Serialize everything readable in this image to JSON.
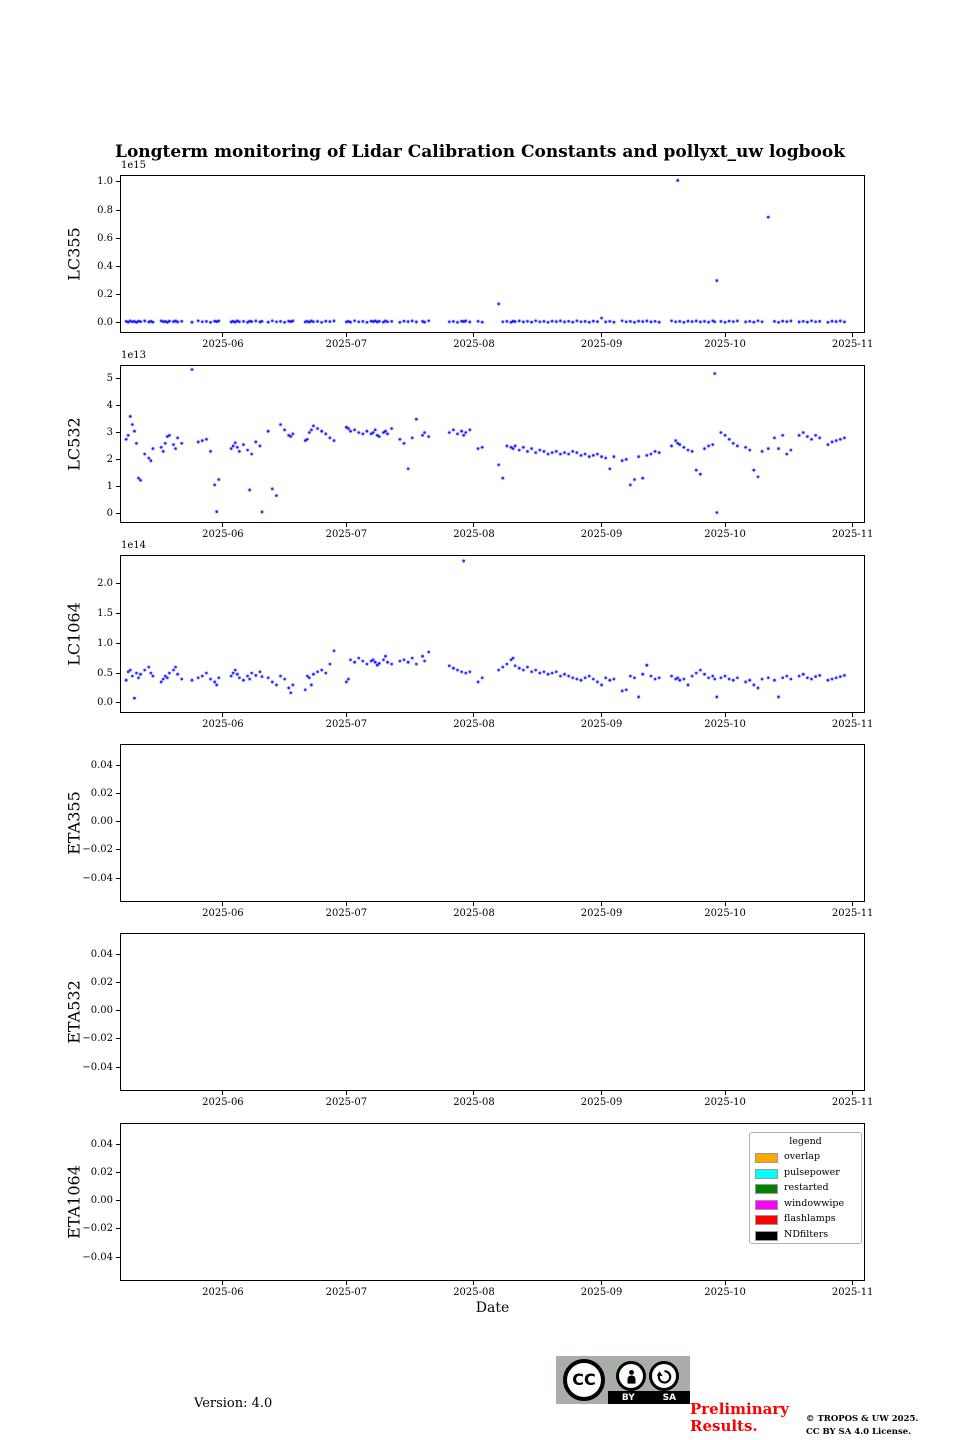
{
  "title": "Longterm monitoring of Lidar Calibration Constants and pollyxt_uw logbook",
  "xlabel": "Date",
  "marker_color": "#0000ff",
  "legend": {
    "title": "legend",
    "entries": [
      {
        "label": "overlap",
        "color": "#ffa500"
      },
      {
        "label": "pulsepower",
        "color": "#00ffff"
      },
      {
        "label": "restarted",
        "color": "#008000"
      },
      {
        "label": "windowwipe",
        "color": "#ff00ff"
      },
      {
        "label": "flashlamps",
        "color": "#ff0000"
      },
      {
        "label": "NDfilters",
        "color": "#000000"
      }
    ]
  },
  "footer": {
    "version": "Version: 4.0",
    "preliminary_line1": "Preliminary",
    "preliminary_line2": "Results.",
    "preliminary_color": "#ff0000",
    "copyright_line1": "© TROPOS & UW 2025.",
    "copyright_line2": "CC BY SA 4.0 License.",
    "cc_badge": {
      "cc_text": "CC",
      "by_label": "BY",
      "sa_label": "SA"
    }
  },
  "chart_data": [
    {
      "type": "scatter",
      "ylabel": "LC355",
      "offset_label": "1e15",
      "ylim": [
        -0.071,
        1.049
      ],
      "yticks": [
        0.0,
        0.2,
        0.4,
        0.6,
        0.8,
        1.0
      ],
      "ytick_labels": [
        "0.0",
        "0.2",
        "0.4",
        "0.6",
        "0.8",
        "1.0"
      ],
      "xlim": [
        0,
        181
      ],
      "x_unit": "days since 2025-05-07",
      "xticks": [
        25,
        55,
        86,
        117,
        147,
        178
      ],
      "xtick_labels": [
        "2025-06",
        "2025-07",
        "2025-08",
        "2025-09",
        "2025-10",
        "2025-11"
      ],
      "x": [
        1.5,
        2,
        2.5,
        3,
        3.5,
        4,
        4.5,
        5,
        6,
        7,
        7.5,
        8,
        10,
        10.5,
        11,
        11.5,
        12,
        13,
        13.5,
        14,
        15,
        17.5,
        19,
        20,
        21,
        22,
        23,
        23.5,
        24,
        27,
        27.5,
        28,
        28.5,
        29,
        30,
        31,
        31.5,
        32,
        33,
        34,
        34.5,
        36,
        37,
        38,
        39,
        40,
        41,
        41.5,
        42,
        45,
        45.5,
        46,
        46.5,
        47,
        48,
        49,
        50,
        51,
        52,
        55,
        55.5,
        56,
        57,
        58,
        59,
        60,
        61,
        61.5,
        62,
        62.5,
        63,
        64,
        64.5,
        65,
        66,
        68,
        69,
        70,
        71,
        72,
        73.5,
        74,
        75,
        80,
        81,
        82,
        83,
        83.5,
        84,
        85,
        87,
        88,
        92,
        93,
        94,
        95,
        95.5,
        96,
        97,
        98,
        99,
        100,
        101,
        102,
        103,
        104,
        105,
        106,
        107,
        108,
        109,
        110,
        111,
        112,
        113,
        114,
        115,
        116,
        117,
        118,
        119,
        120,
        122,
        123,
        124,
        125,
        126,
        127,
        128,
        129,
        130,
        131,
        134,
        135,
        135.5,
        136,
        137,
        138,
        139,
        140,
        141,
        142,
        143,
        144,
        144.5,
        145,
        146,
        147,
        148,
        149,
        150,
        152,
        153,
        154,
        155,
        156,
        157.5,
        159,
        160,
        161,
        162,
        163,
        165,
        166,
        167,
        168,
        169,
        170,
        172,
        173,
        174,
        175,
        176
      ],
      "y": [
        0.012,
        0.006,
        0.015,
        0.008,
        0.011,
        0.005,
        0.013,
        0.009,
        0.014,
        0.007,
        0.012,
        0.006,
        0.015,
        0.008,
        0.011,
        0.005,
        0.013,
        0.009,
        0.014,
        0.007,
        0.012,
        0.006,
        0.015,
        0.008,
        0.011,
        0.005,
        0.013,
        0.009,
        0.014,
        0.007,
        0.012,
        0.006,
        0.015,
        0.008,
        0.011,
        0.005,
        0.013,
        0.009,
        0.014,
        0.007,
        0.012,
        0.006,
        0.015,
        0.008,
        0.011,
        0.005,
        0.013,
        0.009,
        0.014,
        0.007,
        0.012,
        0.006,
        0.015,
        0.008,
        0.011,
        0.005,
        0.013,
        0.009,
        0.014,
        0.007,
        0.012,
        0.006,
        0.015,
        0.008,
        0.011,
        0.005,
        0.013,
        0.009,
        0.014,
        0.007,
        0.012,
        0.006,
        0.015,
        0.008,
        0.011,
        0.005,
        0.013,
        0.009,
        0.014,
        0.007,
        0.012,
        0.006,
        0.015,
        0.008,
        0.011,
        0.005,
        0.013,
        0.009,
        0.014,
        0.007,
        0.012,
        0.006,
        0.135,
        0.008,
        0.011,
        0.005,
        0.013,
        0.009,
        0.014,
        0.007,
        0.012,
        0.006,
        0.015,
        0.008,
        0.011,
        0.005,
        0.013,
        0.009,
        0.014,
        0.007,
        0.012,
        0.006,
        0.015,
        0.008,
        0.011,
        0.005,
        0.013,
        0.009,
        0.035,
        0.007,
        0.012,
        0.006,
        0.015,
        0.008,
        0.011,
        0.005,
        0.013,
        0.009,
        0.014,
        0.007,
        0.012,
        0.006,
        0.015,
        0.008,
        1.01,
        0.011,
        0.005,
        0.013,
        0.009,
        0.014,
        0.007,
        0.012,
        0.006,
        0.015,
        0.008,
        0.3,
        0.011,
        0.005,
        0.013,
        0.009,
        0.014,
        0.007,
        0.012,
        0.006,
        0.015,
        0.008,
        0.75,
        0.011,
        0.005,
        0.013,
        0.009,
        0.014,
        0.007,
        0.012,
        0.006,
        0.015,
        0.008,
        0.011,
        0.005,
        0.013,
        0.009,
        0.014,
        0.007
      ]
    },
    {
      "type": "scatter",
      "ylabel": "LC532",
      "offset_label": "1e13",
      "ylim": [
        -0.37,
        5.52
      ],
      "yticks": [
        0,
        1,
        2,
        3,
        4,
        5
      ],
      "ytick_labels": [
        "0",
        "1",
        "2",
        "3",
        "4",
        "5"
      ],
      "xlim": [
        0,
        181
      ],
      "x_unit": "days since 2025-05-07",
      "xticks": [
        25,
        55,
        86,
        117,
        147,
        178
      ],
      "xtick_labels": [
        "2025-06",
        "2025-07",
        "2025-08",
        "2025-09",
        "2025-10",
        "2025-11"
      ],
      "x": [
        1.5,
        2,
        2.5,
        3,
        3.5,
        4,
        4.5,
        5,
        6,
        7,
        7.5,
        8,
        10,
        10.5,
        11,
        11.5,
        12,
        13,
        13.5,
        14,
        15,
        17.5,
        19,
        20,
        21,
        22,
        23,
        23.5,
        24,
        27,
        27.5,
        28,
        28.5,
        29,
        30,
        31,
        31.5,
        32,
        33,
        34,
        34.5,
        36,
        37,
        38,
        39,
        40,
        41,
        41.5,
        42,
        45,
        45.5,
        46,
        46.5,
        47,
        48,
        49,
        50,
        51,
        52,
        55,
        55.5,
        56,
        57,
        58,
        59,
        60,
        61,
        61.5,
        62,
        62.5,
        63,
        64,
        64.5,
        65,
        66,
        68,
        69,
        70,
        71,
        72,
        73.5,
        74,
        75,
        80,
        81,
        82,
        83,
        83.5,
        84,
        85,
        87,
        88,
        92,
        93,
        94,
        95,
        95.5,
        96,
        97,
        98,
        99,
        100,
        101,
        102,
        103,
        104,
        105,
        106,
        107,
        108,
        109,
        110,
        111,
        112,
        113,
        114,
        115,
        116,
        117,
        118,
        119,
        120,
        122,
        123,
        124,
        125,
        126,
        127,
        128,
        129,
        130,
        131,
        134,
        135,
        135.5,
        136,
        137,
        138,
        139,
        140,
        141,
        142,
        143,
        144,
        144.5,
        145,
        146,
        147,
        148,
        149,
        150,
        152,
        153,
        154,
        155,
        156,
        157.5,
        159,
        160,
        161,
        162,
        163,
        165,
        166,
        167,
        168,
        169,
        170,
        172,
        173,
        174,
        175,
        176
      ],
      "y": [
        2.75,
        2.9,
        3.6,
        3.3,
        3.05,
        2.6,
        1.3,
        1.22,
        2.2,
        2.05,
        1.95,
        2.4,
        2.45,
        2.3,
        2.6,
        2.85,
        2.9,
        2.55,
        2.4,
        2.8,
        2.6,
        5.35,
        2.65,
        2.7,
        2.75,
        2.3,
        1.05,
        0.05,
        1.25,
        2.4,
        2.5,
        2.62,
        2.45,
        2.3,
        2.55,
        2.35,
        0.86,
        2.2,
        2.65,
        2.5,
        0.04,
        3.05,
        0.9,
        0.65,
        3.3,
        3.1,
        2.9,
        2.85,
        2.95,
        2.7,
        2.75,
        3.0,
        3.1,
        3.25,
        3.15,
        3.05,
        2.95,
        2.8,
        2.7,
        3.2,
        3.15,
        3.05,
        3.1,
        3.0,
        2.95,
        3.05,
        2.95,
        3.0,
        3.1,
        2.9,
        2.85,
        3.0,
        3.05,
        2.95,
        3.15,
        2.75,
        2.6,
        1.65,
        2.8,
        3.5,
        2.9,
        3.0,
        2.85,
        3.0,
        3.1,
        2.95,
        3.05,
        2.9,
        3.0,
        3.1,
        2.4,
        2.45,
        1.8,
        1.3,
        2.5,
        2.45,
        2.4,
        2.5,
        2.35,
        2.45,
        2.3,
        2.4,
        2.25,
        2.35,
        2.3,
        2.2,
        2.25,
        2.3,
        2.2,
        2.25,
        2.2,
        2.3,
        2.25,
        2.15,
        2.2,
        2.1,
        2.15,
        2.2,
        2.1,
        2.05,
        1.65,
        2.1,
        1.95,
        2.0,
        1.05,
        1.25,
        2.1,
        1.3,
        2.15,
        2.2,
        2.3,
        2.25,
        2.5,
        2.7,
        2.6,
        2.55,
        2.45,
        2.35,
        2.3,
        1.6,
        1.45,
        2.4,
        2.5,
        2.55,
        5.2,
        0.02,
        3.0,
        2.9,
        2.75,
        2.6,
        2.5,
        2.45,
        2.35,
        1.6,
        1.35,
        2.3,
        2.4,
        2.8,
        2.4,
        2.9,
        2.2,
        2.35,
        2.9,
        3.0,
        2.85,
        2.75,
        2.9,
        2.8,
        2.55,
        2.65,
        2.7,
        2.75,
        2.8
      ]
    },
    {
      "type": "scatter",
      "ylabel": "LC1064",
      "offset_label": "1e14",
      "ylim": [
        -0.167,
        2.47
      ],
      "yticks": [
        0.0,
        0.5,
        1.0,
        1.5,
        2.0
      ],
      "ytick_labels": [
        "0.0",
        "0.5",
        "1.0",
        "1.5",
        "2.0"
      ],
      "xlim": [
        0,
        181
      ],
      "x_unit": "days since 2025-05-07",
      "xticks": [
        25,
        55,
        86,
        117,
        147,
        178
      ],
      "xtick_labels": [
        "2025-06",
        "2025-07",
        "2025-08",
        "2025-09",
        "2025-10",
        "2025-11"
      ],
      "x": [
        1.5,
        2,
        2.5,
        3,
        3.5,
        4,
        4.5,
        5,
        6,
        7,
        7.5,
        8,
        10,
        10.5,
        11,
        11.5,
        12,
        13,
        13.5,
        14,
        15,
        17.5,
        19,
        20,
        21,
        22,
        23,
        23.5,
        24,
        27,
        27.5,
        28,
        28.5,
        29,
        30,
        31,
        31.5,
        32,
        33,
        34,
        34.5,
        36,
        37,
        38,
        39,
        40,
        41,
        41.5,
        42,
        45,
        45.5,
        46,
        46.5,
        47,
        48,
        49,
        50,
        51,
        52,
        55,
        55.5,
        56,
        57,
        58,
        59,
        60,
        61,
        61.5,
        62,
        62.5,
        63,
        64,
        64.5,
        65,
        66,
        68,
        69,
        70,
        71,
        72,
        73.5,
        74,
        75,
        80,
        81,
        82,
        83,
        83.5,
        84,
        85,
        87,
        88,
        92,
        93,
        94,
        95,
        95.5,
        96,
        97,
        98,
        99,
        100,
        101,
        102,
        103,
        104,
        105,
        106,
        107,
        108,
        109,
        110,
        111,
        112,
        113,
        114,
        115,
        116,
        117,
        118,
        119,
        120,
        122,
        123,
        124,
        125,
        126,
        127,
        128,
        129,
        130,
        131,
        134,
        135,
        135.5,
        136,
        137,
        138,
        139,
        140,
        141,
        142,
        143,
        144,
        144.5,
        145,
        146,
        147,
        148,
        149,
        150,
        152,
        153,
        154,
        155,
        156,
        157.5,
        159,
        160,
        161,
        162,
        163,
        165,
        166,
        167,
        168,
        169,
        170,
        172,
        173,
        174,
        175,
        176
      ],
      "y": [
        0.38,
        0.52,
        0.55,
        0.45,
        0.08,
        0.5,
        0.42,
        0.48,
        0.55,
        0.6,
        0.5,
        0.45,
        0.35,
        0.4,
        0.45,
        0.42,
        0.5,
        0.55,
        0.6,
        0.48,
        0.4,
        0.38,
        0.42,
        0.45,
        0.5,
        0.4,
        0.35,
        0.3,
        0.42,
        0.45,
        0.5,
        0.55,
        0.48,
        0.42,
        0.38,
        0.45,
        0.4,
        0.5,
        0.46,
        0.52,
        0.44,
        0.42,
        0.35,
        0.3,
        0.45,
        0.4,
        0.25,
        0.17,
        0.3,
        0.22,
        0.45,
        0.42,
        0.3,
        0.48,
        0.52,
        0.55,
        0.5,
        0.65,
        0.87,
        0.35,
        0.4,
        0.72,
        0.68,
        0.75,
        0.7,
        0.65,
        0.7,
        0.72,
        0.68,
        0.63,
        0.66,
        0.72,
        0.78,
        0.68,
        0.65,
        0.7,
        0.72,
        0.68,
        0.75,
        0.65,
        0.78,
        0.7,
        0.85,
        0.62,
        0.58,
        0.55,
        0.52,
        2.37,
        0.5,
        0.52,
        0.35,
        0.42,
        0.55,
        0.6,
        0.65,
        0.72,
        0.75,
        0.62,
        0.58,
        0.55,
        0.6,
        0.52,
        0.55,
        0.5,
        0.52,
        0.48,
        0.5,
        0.52,
        0.45,
        0.48,
        0.45,
        0.42,
        0.4,
        0.38,
        0.42,
        0.45,
        0.4,
        0.35,
        0.3,
        0.42,
        0.38,
        0.4,
        0.2,
        0.22,
        0.45,
        0.42,
        0.1,
        0.48,
        0.63,
        0.45,
        0.4,
        0.42,
        0.45,
        0.4,
        0.42,
        0.38,
        0.4,
        0.3,
        0.45,
        0.5,
        0.55,
        0.48,
        0.42,
        0.45,
        0.4,
        0.1,
        0.42,
        0.45,
        0.4,
        0.38,
        0.42,
        0.35,
        0.38,
        0.3,
        0.25,
        0.4,
        0.42,
        0.38,
        0.1,
        0.42,
        0.45,
        0.4,
        0.45,
        0.48,
        0.42,
        0.4,
        0.44,
        0.46,
        0.38,
        0.4,
        0.42,
        0.44,
        0.46
      ]
    },
    {
      "type": "scatter",
      "ylabel": "ETA355",
      "offset_label": "",
      "ylim": [
        -0.057,
        0.055
      ],
      "yticks": [
        0.04,
        0.02,
        0.0,
        -0.02,
        -0.04
      ],
      "ytick_labels": [
        "0.04",
        "0.02",
        "0.00",
        "−0.02",
        "−0.04"
      ],
      "xlim": [
        0,
        181
      ],
      "x_unit": "days since 2025-05-07",
      "xticks": [
        25,
        55,
        86,
        117,
        147,
        178
      ],
      "xtick_labels": [
        "2025-06",
        "2025-07",
        "2025-08",
        "2025-09",
        "2025-10",
        "2025-11"
      ],
      "x": [],
      "y": []
    },
    {
      "type": "scatter",
      "ylabel": "ETA532",
      "offset_label": "",
      "ylim": [
        -0.057,
        0.055
      ],
      "yticks": [
        0.04,
        0.02,
        0.0,
        -0.02,
        -0.04
      ],
      "ytick_labels": [
        "0.04",
        "0.02",
        "0.00",
        "−0.02",
        "−0.04"
      ],
      "xlim": [
        0,
        181
      ],
      "x_unit": "days since 2025-05-07",
      "xticks": [
        25,
        55,
        86,
        117,
        147,
        178
      ],
      "xtick_labels": [
        "2025-06",
        "2025-07",
        "2025-08",
        "2025-09",
        "2025-10",
        "2025-11"
      ],
      "x": [],
      "y": []
    },
    {
      "type": "scatter",
      "ylabel": "ETA1064",
      "offset_label": "",
      "ylim": [
        -0.057,
        0.055
      ],
      "yticks": [
        0.04,
        0.02,
        0.0,
        -0.02,
        -0.04
      ],
      "ytick_labels": [
        "0.04",
        "0.02",
        "0.00",
        "−0.02",
        "−0.04"
      ],
      "xlim": [
        0,
        181
      ],
      "x_unit": "days since 2025-05-07",
      "xticks": [
        25,
        55,
        86,
        117,
        147,
        178
      ],
      "xtick_labels": [
        "2025-06",
        "2025-07",
        "2025-08",
        "2025-09",
        "2025-10",
        "2025-11"
      ],
      "x": [],
      "y": [],
      "has_legend": true
    }
  ]
}
